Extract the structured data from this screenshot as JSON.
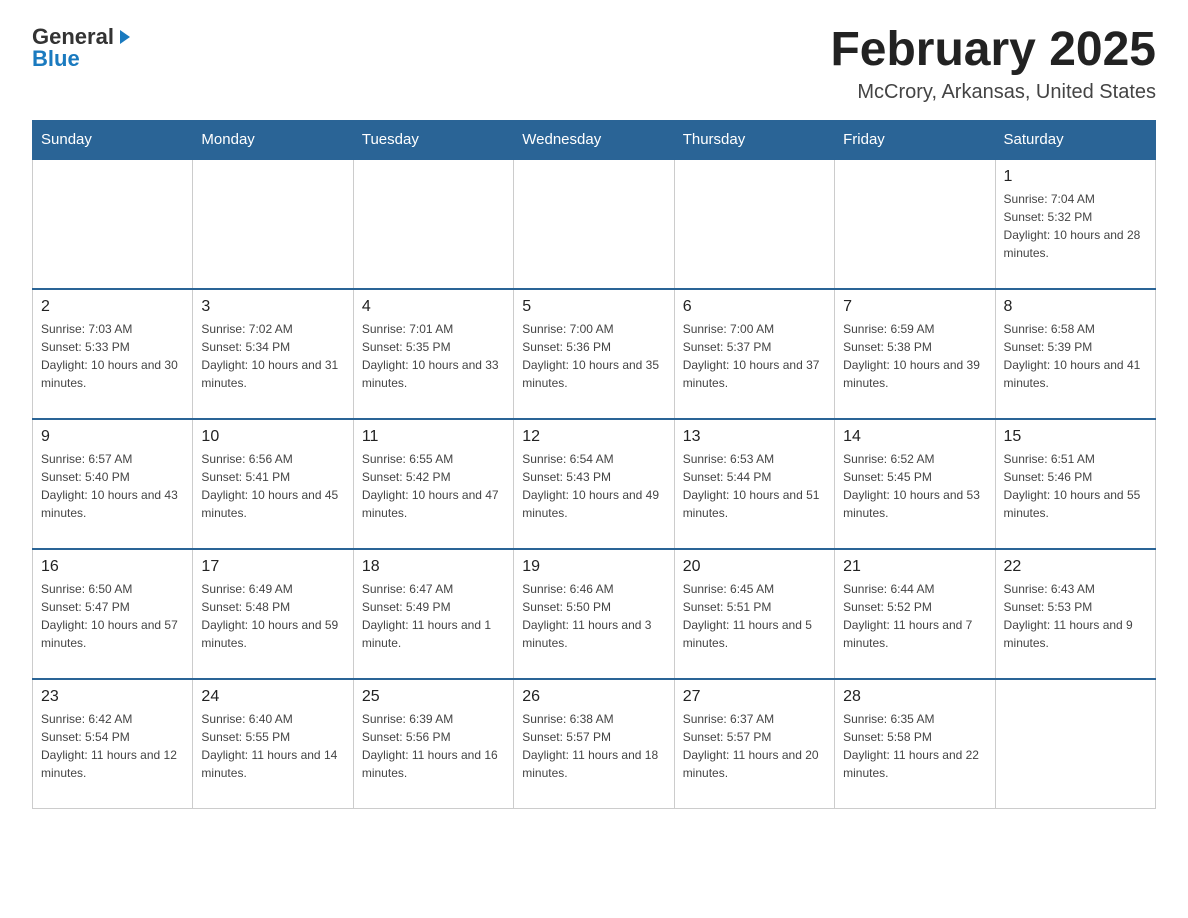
{
  "header": {
    "logo_general": "General",
    "logo_blue": "Blue",
    "title": "February 2025",
    "subtitle": "McCrory, Arkansas, United States"
  },
  "days_of_week": [
    "Sunday",
    "Monday",
    "Tuesday",
    "Wednesday",
    "Thursday",
    "Friday",
    "Saturday"
  ],
  "weeks": [
    [
      {
        "day": "",
        "info": ""
      },
      {
        "day": "",
        "info": ""
      },
      {
        "day": "",
        "info": ""
      },
      {
        "day": "",
        "info": ""
      },
      {
        "day": "",
        "info": ""
      },
      {
        "day": "",
        "info": ""
      },
      {
        "day": "1",
        "info": "Sunrise: 7:04 AM\nSunset: 5:32 PM\nDaylight: 10 hours and 28 minutes."
      }
    ],
    [
      {
        "day": "2",
        "info": "Sunrise: 7:03 AM\nSunset: 5:33 PM\nDaylight: 10 hours and 30 minutes."
      },
      {
        "day": "3",
        "info": "Sunrise: 7:02 AM\nSunset: 5:34 PM\nDaylight: 10 hours and 31 minutes."
      },
      {
        "day": "4",
        "info": "Sunrise: 7:01 AM\nSunset: 5:35 PM\nDaylight: 10 hours and 33 minutes."
      },
      {
        "day": "5",
        "info": "Sunrise: 7:00 AM\nSunset: 5:36 PM\nDaylight: 10 hours and 35 minutes."
      },
      {
        "day": "6",
        "info": "Sunrise: 7:00 AM\nSunset: 5:37 PM\nDaylight: 10 hours and 37 minutes."
      },
      {
        "day": "7",
        "info": "Sunrise: 6:59 AM\nSunset: 5:38 PM\nDaylight: 10 hours and 39 minutes."
      },
      {
        "day": "8",
        "info": "Sunrise: 6:58 AM\nSunset: 5:39 PM\nDaylight: 10 hours and 41 minutes."
      }
    ],
    [
      {
        "day": "9",
        "info": "Sunrise: 6:57 AM\nSunset: 5:40 PM\nDaylight: 10 hours and 43 minutes."
      },
      {
        "day": "10",
        "info": "Sunrise: 6:56 AM\nSunset: 5:41 PM\nDaylight: 10 hours and 45 minutes."
      },
      {
        "day": "11",
        "info": "Sunrise: 6:55 AM\nSunset: 5:42 PM\nDaylight: 10 hours and 47 minutes."
      },
      {
        "day": "12",
        "info": "Sunrise: 6:54 AM\nSunset: 5:43 PM\nDaylight: 10 hours and 49 minutes."
      },
      {
        "day": "13",
        "info": "Sunrise: 6:53 AM\nSunset: 5:44 PM\nDaylight: 10 hours and 51 minutes."
      },
      {
        "day": "14",
        "info": "Sunrise: 6:52 AM\nSunset: 5:45 PM\nDaylight: 10 hours and 53 minutes."
      },
      {
        "day": "15",
        "info": "Sunrise: 6:51 AM\nSunset: 5:46 PM\nDaylight: 10 hours and 55 minutes."
      }
    ],
    [
      {
        "day": "16",
        "info": "Sunrise: 6:50 AM\nSunset: 5:47 PM\nDaylight: 10 hours and 57 minutes."
      },
      {
        "day": "17",
        "info": "Sunrise: 6:49 AM\nSunset: 5:48 PM\nDaylight: 10 hours and 59 minutes."
      },
      {
        "day": "18",
        "info": "Sunrise: 6:47 AM\nSunset: 5:49 PM\nDaylight: 11 hours and 1 minute."
      },
      {
        "day": "19",
        "info": "Sunrise: 6:46 AM\nSunset: 5:50 PM\nDaylight: 11 hours and 3 minutes."
      },
      {
        "day": "20",
        "info": "Sunrise: 6:45 AM\nSunset: 5:51 PM\nDaylight: 11 hours and 5 minutes."
      },
      {
        "day": "21",
        "info": "Sunrise: 6:44 AM\nSunset: 5:52 PM\nDaylight: 11 hours and 7 minutes."
      },
      {
        "day": "22",
        "info": "Sunrise: 6:43 AM\nSunset: 5:53 PM\nDaylight: 11 hours and 9 minutes."
      }
    ],
    [
      {
        "day": "23",
        "info": "Sunrise: 6:42 AM\nSunset: 5:54 PM\nDaylight: 11 hours and 12 minutes."
      },
      {
        "day": "24",
        "info": "Sunrise: 6:40 AM\nSunset: 5:55 PM\nDaylight: 11 hours and 14 minutes."
      },
      {
        "day": "25",
        "info": "Sunrise: 6:39 AM\nSunset: 5:56 PM\nDaylight: 11 hours and 16 minutes."
      },
      {
        "day": "26",
        "info": "Sunrise: 6:38 AM\nSunset: 5:57 PM\nDaylight: 11 hours and 18 minutes."
      },
      {
        "day": "27",
        "info": "Sunrise: 6:37 AM\nSunset: 5:57 PM\nDaylight: 11 hours and 20 minutes."
      },
      {
        "day": "28",
        "info": "Sunrise: 6:35 AM\nSunset: 5:58 PM\nDaylight: 11 hours and 22 minutes."
      },
      {
        "day": "",
        "info": ""
      }
    ]
  ]
}
